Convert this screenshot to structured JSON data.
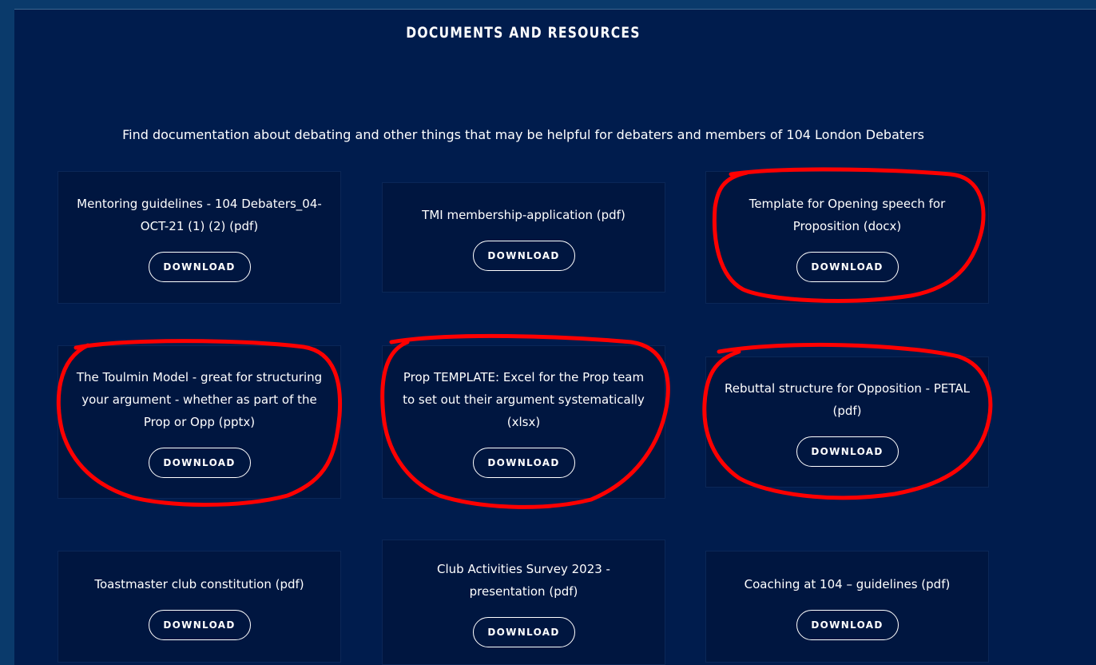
{
  "section": {
    "title": "DOCUMENTS AND RESOURCES",
    "intro": "Find documentation about debating and other things that may be helpful for debaters and members of 104 London Debaters"
  },
  "documents": [
    {
      "title": "Mentoring guidelines - 104 Debaters_04-OCT-21 (1) (2) (pdf)",
      "button": "DOWNLOAD",
      "highlighted": false
    },
    {
      "title": "TMI membership-application (pdf)",
      "button": "DOWNLOAD",
      "highlighted": false
    },
    {
      "title": "Template for Opening speech for Proposition (docx)",
      "button": "DOWNLOAD",
      "highlighted": true
    },
    {
      "title": "The Toulmin Model - great for structuring your argument - whether as part of the Prop or Opp (pptx)",
      "button": "DOWNLOAD",
      "highlighted": true
    },
    {
      "title": "Prop TEMPLATE: Excel for the Prop team to set out their argument systematically (xlsx)",
      "button": "DOWNLOAD",
      "highlighted": true
    },
    {
      "title": "Rebuttal structure for Opposition - PETAL (pdf)",
      "button": "DOWNLOAD",
      "highlighted": true
    },
    {
      "title": "Toastmaster club constitution (pdf)",
      "button": "DOWNLOAD",
      "highlighted": false
    },
    {
      "title": "Club Activities Survey 2023 - presentation (pdf)",
      "button": "DOWNLOAD",
      "highlighted": false
    },
    {
      "title": "Coaching at 104 – guidelines (pdf)",
      "button": "DOWNLOAD",
      "highlighted": false
    }
  ],
  "colors": {
    "page_background": "#0a3a6b",
    "panel_background": "#001c4d",
    "card_background": "#001640",
    "annotation": "#ff0000"
  }
}
